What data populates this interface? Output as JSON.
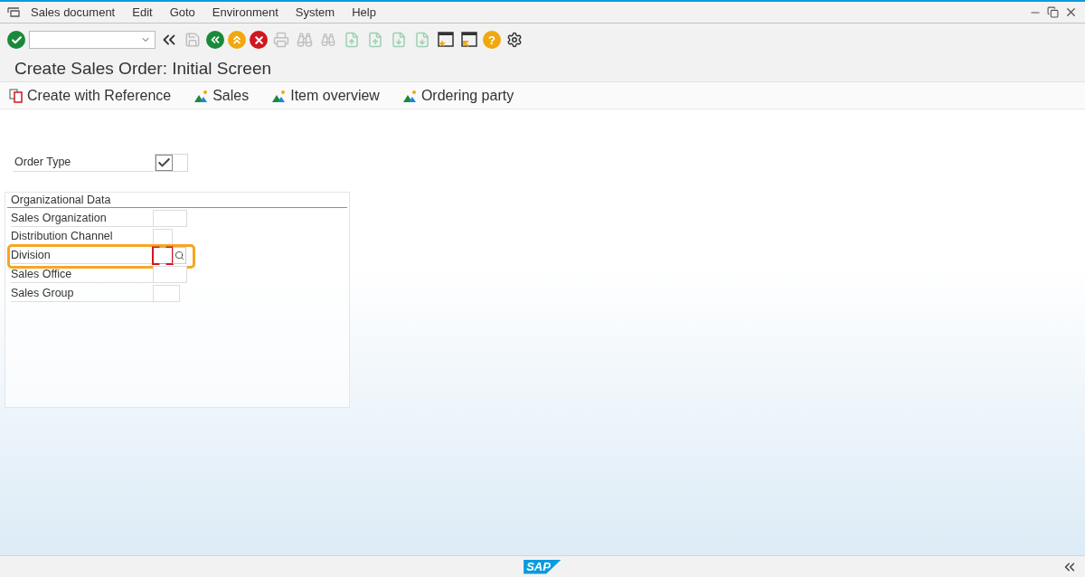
{
  "menu": [
    {
      "label": "Sales document"
    },
    {
      "label": "Edit"
    },
    {
      "label": "Goto"
    },
    {
      "label": "Environment"
    },
    {
      "label": "System"
    },
    {
      "label": "Help"
    }
  ],
  "toolbar": [
    {
      "kind": "enter",
      "disabled": false
    },
    {
      "kind": "command-field",
      "disabled": false
    },
    {
      "kind": "collapse",
      "disabled": false
    },
    {
      "kind": "save",
      "disabled": true
    },
    {
      "kind": "back",
      "disabled": false
    },
    {
      "kind": "exit",
      "disabled": false
    },
    {
      "kind": "cancel",
      "disabled": false
    },
    {
      "kind": "print",
      "disabled": true
    },
    {
      "kind": "find",
      "disabled": true
    },
    {
      "kind": "find-next",
      "disabled": true
    },
    {
      "kind": "first-page",
      "disabled": true
    },
    {
      "kind": "previous-page",
      "disabled": true
    },
    {
      "kind": "next-page",
      "disabled": true
    },
    {
      "kind": "last-page",
      "disabled": true
    },
    {
      "kind": "new-session",
      "disabled": false
    },
    {
      "kind": "shortcut",
      "disabled": false
    },
    {
      "kind": "help",
      "disabled": false,
      "label": "?"
    },
    {
      "kind": "settings",
      "disabled": false
    }
  ],
  "title": "Create Sales Order: Initial Screen",
  "app_toolbar": [
    {
      "kind": "reference",
      "label": "Create with Reference"
    },
    {
      "kind": "overview",
      "label": "Sales"
    },
    {
      "kind": "overview",
      "label": "Item overview"
    },
    {
      "kind": "overview",
      "label": "Ordering party"
    }
  ],
  "order_type": {
    "label": "Order Type",
    "required": true
  },
  "group": {
    "title": "Organizational Data",
    "fields": [
      {
        "label": "Sales Organization",
        "focused": false,
        "highlighted": false,
        "search_help": false
      },
      {
        "label": "Distribution Channel",
        "focused": false,
        "highlighted": false,
        "search_help": false
      },
      {
        "label": "Division",
        "focused": true,
        "highlighted": true,
        "search_help": true
      },
      {
        "label": "Sales Office",
        "focused": false,
        "highlighted": false,
        "search_help": false
      },
      {
        "label": "Sales Group",
        "focused": false,
        "highlighted": false,
        "search_help": false
      }
    ]
  },
  "status_bar": {
    "logo_text": "SAP"
  }
}
